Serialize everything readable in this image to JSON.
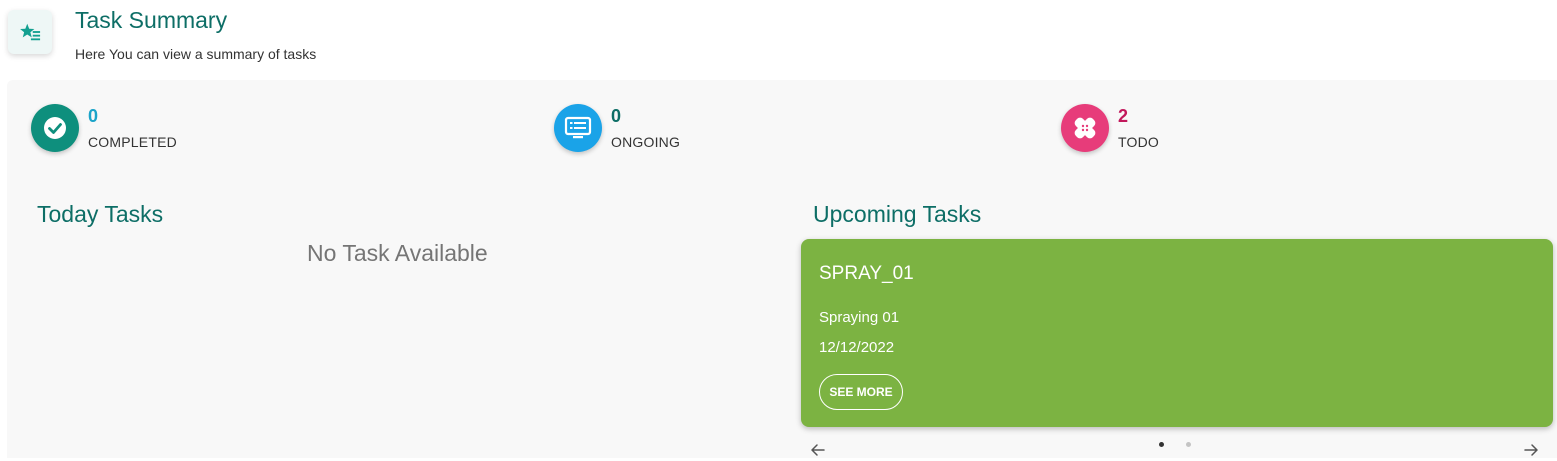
{
  "header": {
    "icon": "star-list-icon",
    "title": "Task Summary",
    "subtitle": "Here You can view a summary of tasks"
  },
  "stats": [
    {
      "count": "0",
      "label": "COMPLETED",
      "icon": "check-circle-icon",
      "color": "#0e8f7d",
      "count_color": "#1ba4c9"
    },
    {
      "count": "0",
      "label": "ONGOING",
      "icon": "monitor-list-icon",
      "color": "#1aa3e8",
      "count_color": "#0d6e66"
    },
    {
      "count": "2",
      "label": "TODO",
      "icon": "bandage-icon",
      "color": "#e73c7a",
      "count_color": "#c2185b"
    }
  ],
  "today": {
    "title": "Today Tasks",
    "empty_text": "No Task Available"
  },
  "upcoming": {
    "title": "Upcoming Tasks",
    "card": {
      "title": "SPRAY_01",
      "description": "Spraying 01",
      "date": "12/12/2022",
      "button_label": "SEE MORE",
      "color": "#7cb342"
    },
    "carousel": {
      "prev_icon": "arrow-left-icon",
      "next_icon": "arrow-right-icon",
      "page_count": 2,
      "active_page": 1
    }
  }
}
